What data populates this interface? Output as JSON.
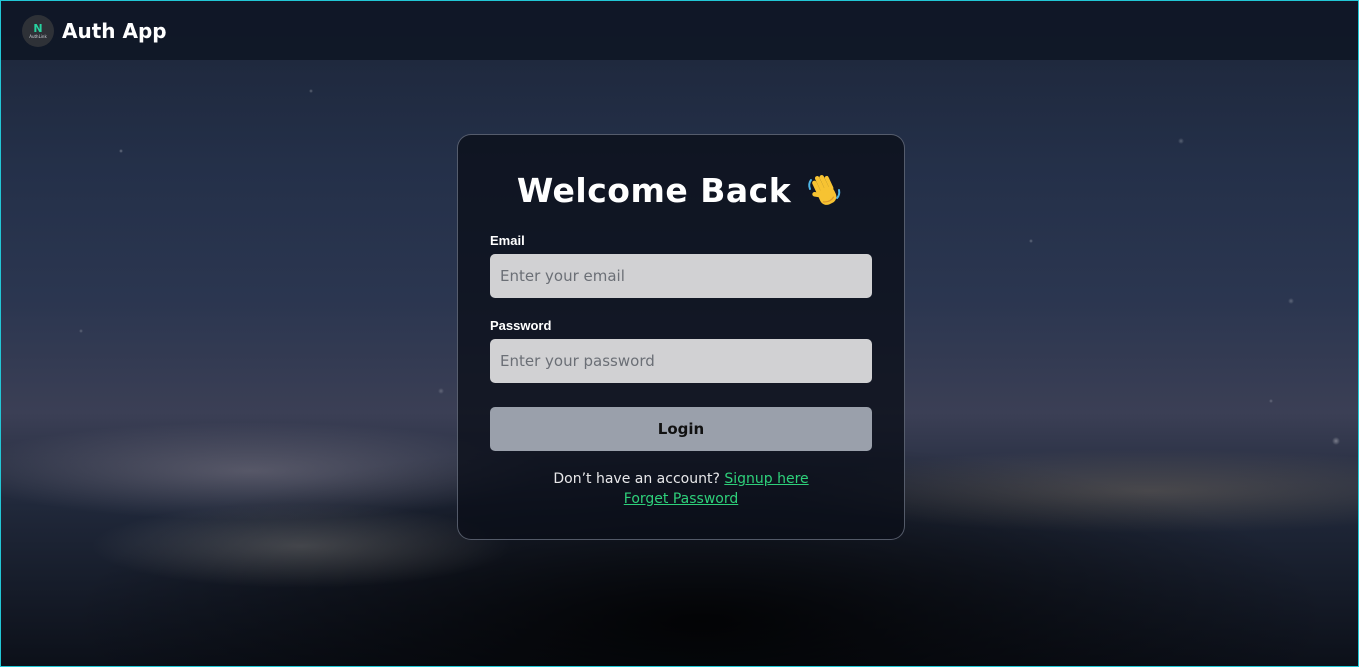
{
  "navbar": {
    "logo_mark": "N",
    "logo_caption": "AuthLink",
    "brand": "Auth App"
  },
  "card": {
    "title": "Welcome Back",
    "title_icon": "waving-hand-icon",
    "email": {
      "label": "Email",
      "placeholder": "Enter your email",
      "value": ""
    },
    "password": {
      "label": "Password",
      "placeholder": "Enter your password",
      "value": ""
    },
    "login_label": "Login",
    "signup_prompt": "Don’t have an account?",
    "signup_link": "Signup here",
    "forgot_link": "Forget Password"
  },
  "colors": {
    "frame_border": "#22c7d6",
    "link": "#2ed07a",
    "input_bg": "#d1d1d3",
    "button_bg": "#9aa0ab"
  }
}
